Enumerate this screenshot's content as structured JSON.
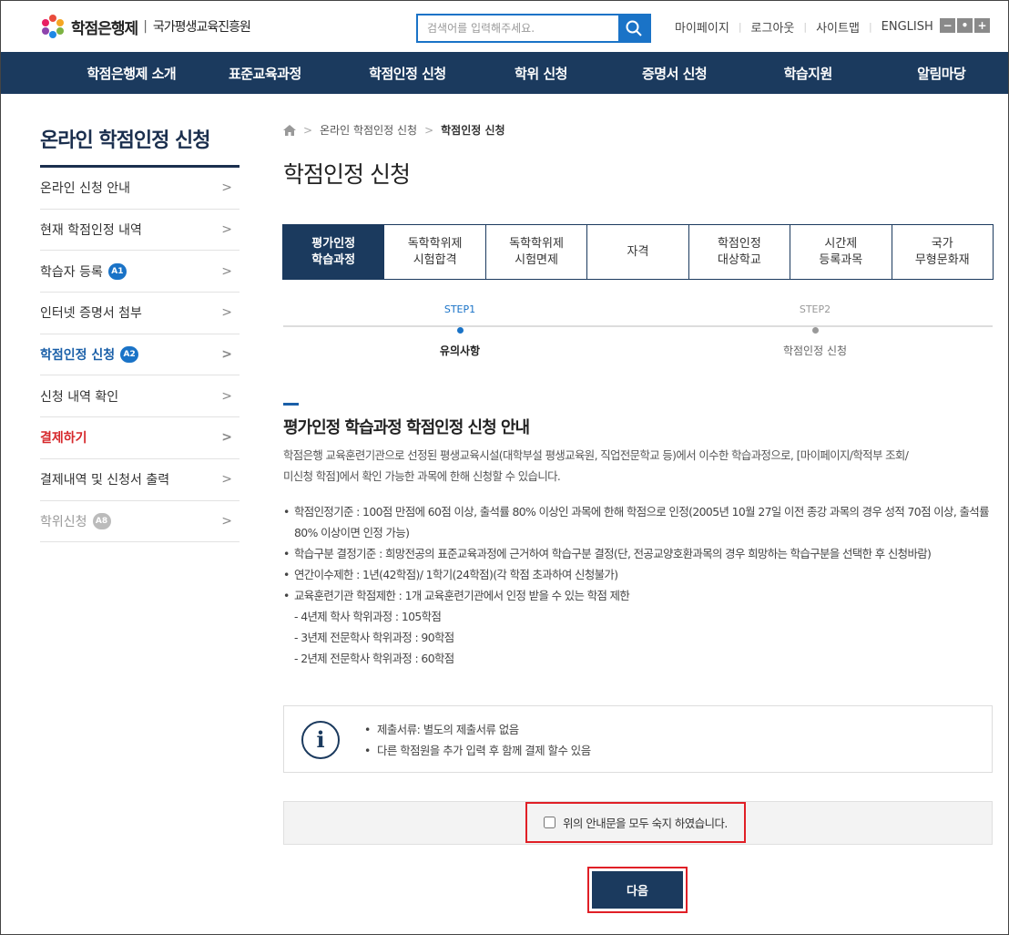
{
  "header": {
    "logo_name": "학점은행제",
    "logo_sep": "|",
    "logo_org": "국가평생교육진흥원",
    "search_placeholder": "검색어를 입력해주세요.",
    "util_links": [
      "마이페이지",
      "로그아웃",
      "사이트맵",
      "ENGLISH"
    ],
    "zoom": [
      "−",
      "•",
      "+"
    ]
  },
  "nav": [
    "학점은행제 소개",
    "표준교육과정",
    "학점인정 신청",
    "학위 신청",
    "증명서 신청",
    "학습지원",
    "알림마당"
  ],
  "sidebar": {
    "title": "온라인 학점인정 신청",
    "items": [
      {
        "label": "온라인 신청 안내",
        "badge": "",
        "state": "normal"
      },
      {
        "label": "현재 학점인정 내역",
        "badge": "",
        "state": "normal"
      },
      {
        "label": "학습자 등록",
        "badge": "A1",
        "state": "normal"
      },
      {
        "label": "인터넷 증명서 첨부",
        "badge": "",
        "state": "normal"
      },
      {
        "label": "학점인정 신청",
        "badge": "A2",
        "state": "active"
      },
      {
        "label": "신청 내역 확인",
        "badge": "",
        "state": "normal"
      },
      {
        "label": "결제하기",
        "badge": "",
        "state": "red"
      },
      {
        "label": "결제내역 및 신청서 출력",
        "badge": "",
        "state": "normal"
      },
      {
        "label": "학위신청",
        "badge": "A8",
        "state": "dim"
      }
    ]
  },
  "breadcrumb": [
    "온라인 학점인정 신청",
    "학점인정 신청"
  ],
  "page_title": "학점인정 신청",
  "tabs": [
    {
      "label": "평가인정\n학습과정",
      "active": true
    },
    {
      "label": "독학학위제\n시험합격",
      "active": false
    },
    {
      "label": "독학학위제\n시험면제",
      "active": false
    },
    {
      "label": "자격",
      "active": false
    },
    {
      "label": "학점인정\n대상학교",
      "active": false
    },
    {
      "label": "시간제\n등록과목",
      "active": false
    },
    {
      "label": "국가\n무형문화재",
      "active": false
    }
  ],
  "steps": [
    {
      "no": "STEP1",
      "name": "유의사항",
      "active": true
    },
    {
      "no": "STEP2",
      "name": "학점인정 신청",
      "active": false
    }
  ],
  "section": {
    "title": "평가인정 학습과정 학점인정 신청 안내",
    "intro_1": "학점은행 교육훈련기관으로 선정된 평생교육시설(대학부설 평생교육원, 직업전문학교 등)에서 이수한 학습과정으로, [마이페이지/학적부 조회/",
    "intro_2": "미신청 학점]에서 확인 가능한 과목에 한해 신청할 수 있습니다.",
    "rules": [
      "학점인정기준 : 100점 만점에 60점 이상, 출석률 80% 이상인 과목에 한해 학점으로 인정(2005년 10월 27일 이전 종강 과목의 경우 성적 70점 이상, 출석률 80% 이상이면 인정 가능)",
      "학습구분 결정기준 : 희망전공의 표준교육과정에 근거하여 학습구분 결정(단, 전공교양호환과목의 경우 희망하는 학습구분을 선택한 후 신청바람)",
      "연간이수제한 : 1년(42학점)/ 1학기(24학점)(각 학점 초과하여 신청불가)",
      "교육훈련기관 학점제한 : 1개 교육훈련기관에서 인정 받을 수 있는 학점 제한"
    ],
    "sub_rules": [
      "- 4년제 학사 학위과정 : 105학점",
      "- 3년제 전문학사 학위과정 : 90학점",
      "- 2년제 전문학사 학위과정 : 60학점"
    ]
  },
  "info": {
    "icon": "i",
    "items": [
      "제출서류: 별도의 제출서류 없음",
      "다른 학점원을 추가 입력 후 함께 결제 할수 있음"
    ]
  },
  "agree_label": "위의 안내문을 모두 숙지 하였습니다.",
  "next_label": "다음",
  "colors": {
    "navy": "#1b3a5e",
    "blue": "#1a73c7",
    "red": "#e01f26"
  }
}
